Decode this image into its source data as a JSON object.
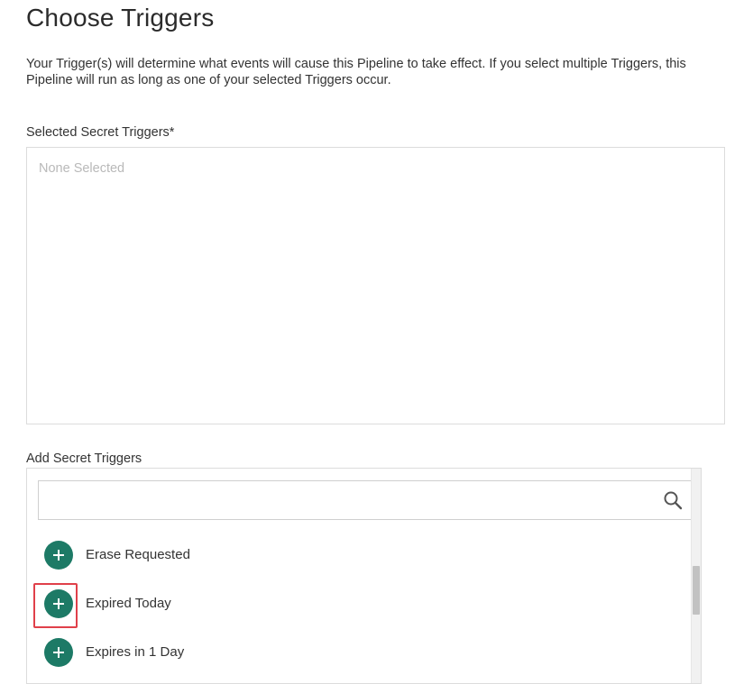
{
  "page": {
    "title": "Choose Triggers",
    "description": "Your Trigger(s) will determine what events will cause this Pipeline to take effect. If you select multiple Triggers, this Pipeline will run as long as one of your selected Triggers occur."
  },
  "selected": {
    "label": "Selected Secret Triggers*",
    "placeholder": "None Selected"
  },
  "add": {
    "label": "Add Secret Triggers",
    "search": {
      "value": "",
      "placeholder": ""
    },
    "items": [
      {
        "label": "Erase Requested"
      },
      {
        "label": "Expired Today"
      },
      {
        "label": "Expires in 1 Day"
      }
    ]
  },
  "theme": {
    "accent": "#1d7a66",
    "highlight": "#e0404a"
  },
  "icons": {
    "search": "search-icon",
    "add": "plus-circle-icon"
  }
}
